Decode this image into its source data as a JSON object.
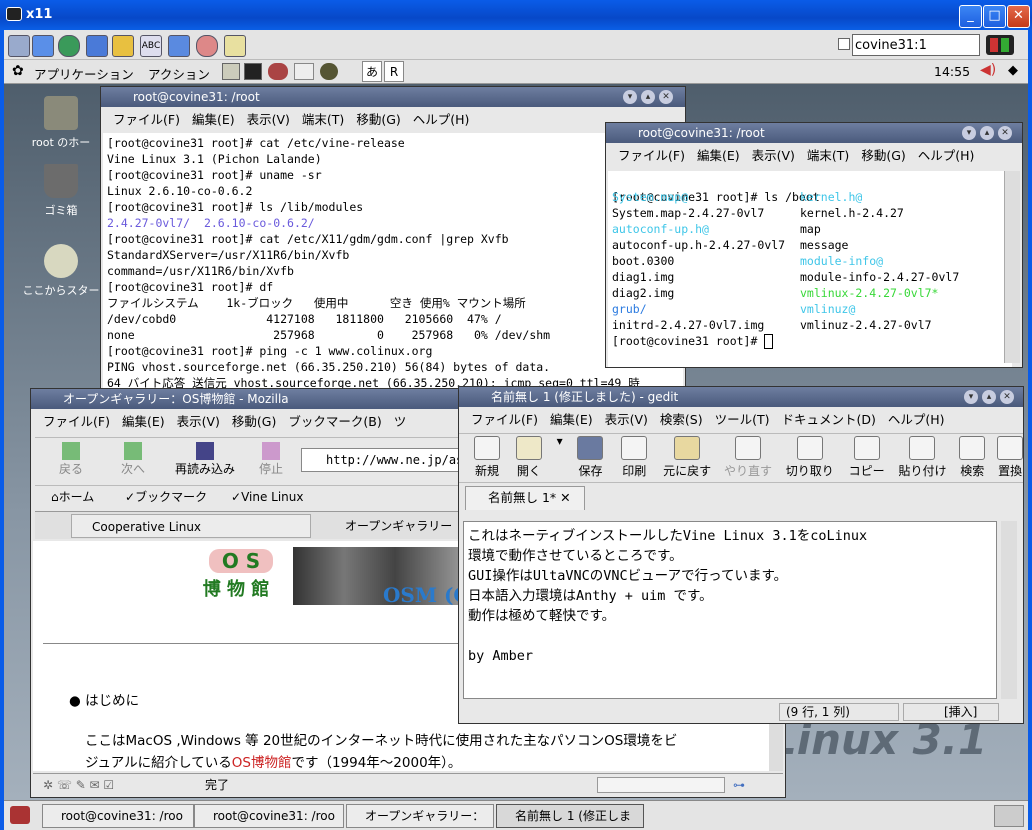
{
  "xwin": {
    "title": "x11"
  },
  "panel": {
    "search_value": "covine31:1",
    "menu_apps": "アプリケーション",
    "menu_actions": "アクション",
    "input_mode": "あ",
    "input_r": "R",
    "clock": "14:55"
  },
  "desktop": {
    "icons": [
      {
        "label": "root のホー"
      },
      {
        "label": "ゴミ箱"
      },
      {
        "label": "ここからスター"
      }
    ],
    "watermark": "Linux 3.1"
  },
  "term1": {
    "title": "root@covine31: /root",
    "menu": [
      "ファイル(F)",
      "編集(E)",
      "表示(V)",
      "端末(T)",
      "移動(G)",
      "ヘルプ(H)"
    ],
    "lines": [
      "[root@covine31 root]# cat /etc/vine-release",
      "Vine Linux 3.1 (Pichon Lalande)",
      "[root@covine31 root]# uname -sr",
      "Linux 2.6.10-co-0.6.2",
      "[root@covine31 root]# ls /lib/modules"
    ],
    "mod_a": "2.4.27-0vl7/",
    "mod_b": "2.6.10-co-0.6.2/",
    "lines2": [
      "[root@covine31 root]# cat /etc/X11/gdm/gdm.conf |grep Xvfb",
      "StandardXServer=/usr/X11R6/bin/Xvfb",
      "command=/usr/X11R6/bin/Xvfb",
      "[root@covine31 root]# df",
      "ファイルシステム    1k-ブロック   使用中      空き 使用% マウント場所",
      "/dev/cobd0             4127108   1811800   2105660  47% /",
      "none                    257968         0    257968   0% /dev/shm",
      "[root@covine31 root]# ping -c 1 www.colinux.org",
      "PING vhost.sourceforge.net (66.35.250.210) 56(84) bytes of data.",
      "64 バイト応答 送信元 vhost.sourceforge.net (66.35.250.210): icmp_seq=0 ttl=49 時"
    ]
  },
  "term2": {
    "title": "root@covine31: /root",
    "menu": [
      "ファイル(F)",
      "編集(E)",
      "表示(V)",
      "端末(T)",
      "移動(G)",
      "ヘルプ(H)"
    ],
    "prompt": "[root@covine31 root]# ls /boot",
    "left": [
      "System.map@",
      "System.map-2.4.27-0vl7",
      "autoconf-up.h@",
      "autoconf-up.h-2.4.27-0vl7",
      "boot.0300",
      "diag1.img",
      "diag2.img",
      "grub/",
      "initrd-2.4.27-0vl7.img"
    ],
    "right": [
      "kernel.h@",
      "kernel.h-2.4.27",
      "map",
      "message",
      "module-info@",
      "module-info-2.4.27-0vl7",
      "vmlinux-2.4.27-0vl7*",
      "vmlinuz@",
      "vmlinuz-2.4.27-0vl7"
    ],
    "last": "[root@covine31 root]# "
  },
  "mozilla": {
    "title": "オープンギャラリー：OS博物館 - Mozilla",
    "menu": [
      "ファイル(F)",
      "編集(E)",
      "表示(V)",
      "移動(G)",
      "ブックマーク(B)",
      "ツ"
    ],
    "back": "戻る",
    "forward": "次へ",
    "reload": "再読み込み",
    "stop": "停止",
    "url": "http://www.ne.jp/as",
    "home": "ホーム",
    "bookmarks": "ブックマーク",
    "vine": "Vine Linux",
    "tab1": "Cooperative Linux",
    "tab2": "オープンギャラリー",
    "logo_os": "O S",
    "logo_museum": "博 物 館",
    "banner": "OSM (O",
    "bullet": "はじめに",
    "para1a": "ここはMacOS ,Windows 等 20世紀のインターネット時代に使用された主なパソコンOS環境をビ",
    "para2a": "ジュアルに紹介している",
    "para2link": "OS博物館",
    "para2b": "です（1994年～2000年）。",
    "status": "完了"
  },
  "gedit": {
    "title": "名前無し 1 (修正しました) - gedit",
    "menu": [
      "ファイル(F)",
      "編集(E)",
      "表示(V)",
      "検索(S)",
      "ツール(T)",
      "ドキュメント(D)",
      "ヘルプ(H)"
    ],
    "tools": {
      "new": "新規",
      "open": "開く",
      "save": "保存",
      "print": "印刷",
      "undo": "元に戻す",
      "redo": "やり直す",
      "cut": "切り取り",
      "copy": "コピー",
      "paste": "貼り付け",
      "find": "検索",
      "replace": "置換"
    },
    "tab": "名前無し 1*",
    "text": [
      "これはネーティブインストールしたVine Linux 3.1をcoLinux",
      "環境で動作させているところです。",
      "GUI操作はUltaVNCのVNCビューアで行っています。",
      "日本語入力環境はAnthy + uim です。",
      "動作は極めて軽快です。",
      "",
      "by Amber"
    ],
    "pos": "(9 行, 1 列)",
    "mode": "[挿入]"
  },
  "taskbar": {
    "items": [
      "root@covine31: /roo",
      "root@covine31: /roo",
      "オープンギャラリー：",
      "名前無し 1 (修正しま"
    ]
  }
}
